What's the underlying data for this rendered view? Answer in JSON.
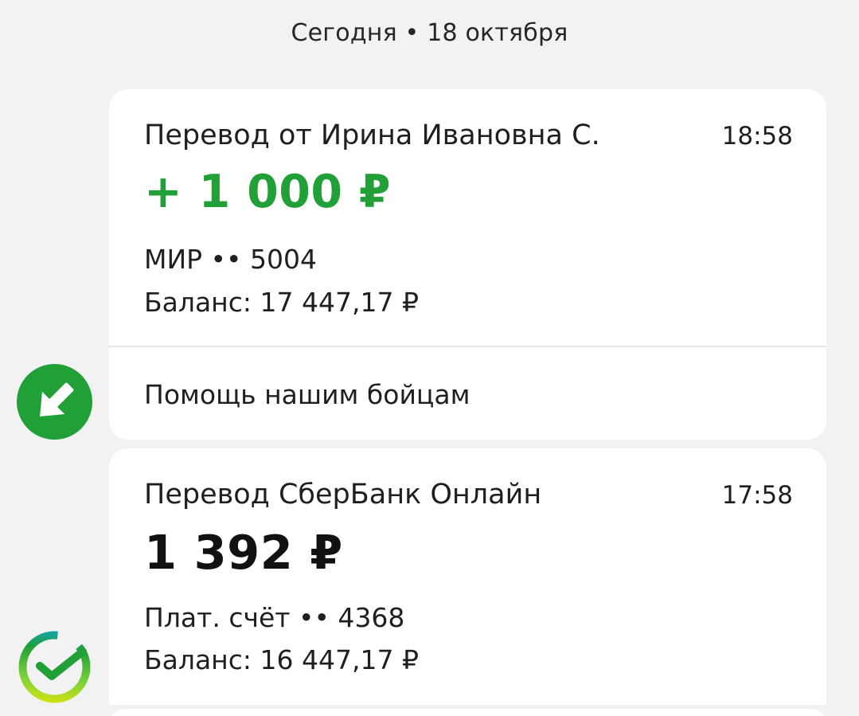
{
  "date_header": "Сегодня • 18 октября",
  "transactions": [
    {
      "title": "Перевод от Ирина Ивановна С.",
      "time": "18:58",
      "amount": "+ 1 000 ₽",
      "account": "МИР •• 5004",
      "balance": "Баланс: 17 447,17 ₽",
      "message": "Помощь нашим бойцам",
      "icon": "incoming-arrow-icon",
      "amount_color": "#21a038"
    },
    {
      "title": "Перевод СберБанк Онлайн",
      "time": "17:58",
      "amount": "1 392 ₽",
      "account": "Плат. счёт •• 4368",
      "balance": "Баланс: 16 447,17 ₽",
      "icon": "sberbank-logo-icon",
      "amount_color": "#111111"
    }
  ]
}
